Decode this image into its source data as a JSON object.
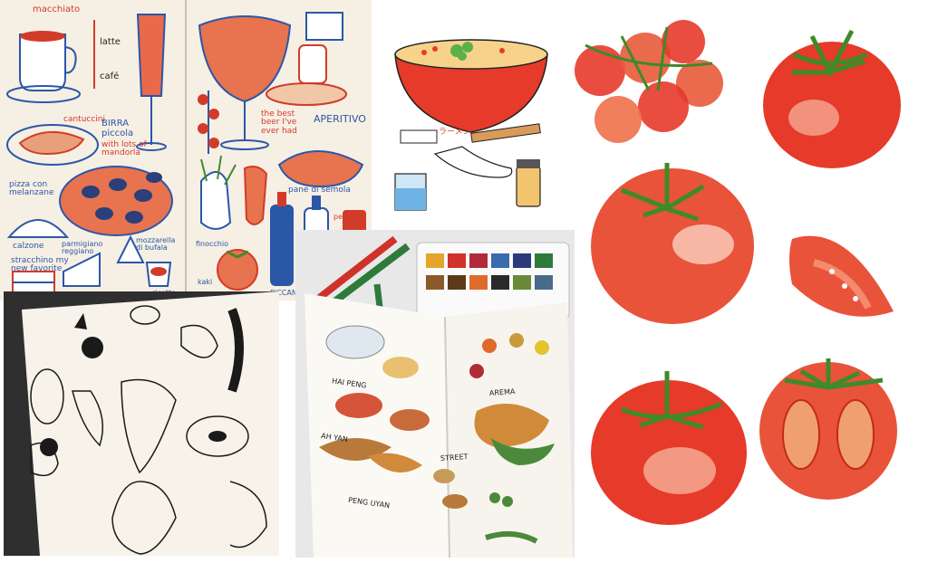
{
  "food_sketchbook": {
    "p1": "macchiato",
    "p2": "latte",
    "p3": "café",
    "p4": "cantuccini",
    "p5": "BIRRA piccola",
    "p6": "with lots of mandorla",
    "p7": "pizza con melanzane",
    "p8": "calzone",
    "p9": "parmigiano reggiano",
    "p10": "mozzarella di bufala",
    "p11": "stracchino my new favorite",
    "p12": "ricotta",
    "p13": "the best beer I've ever had",
    "p14": "APERITIVO",
    "p15": "pane di semola",
    "p16": "finocchio",
    "p17": "kaki",
    "p18": "PICCANTE",
    "p19": "per"
  },
  "ramen_illustration": {
    "chopstick_wrapper_text": "ラーメン"
  },
  "travel_sketchbook": {
    "t1": "HAI PENG",
    "t2": "AH YAN",
    "t3": "AREMA",
    "t4": "STREET",
    "t5": "PENG UYAN"
  },
  "colors": {
    "tomato_red": "#e63a2a",
    "tomato_light": "#f58a6e",
    "stem_green": "#3f8a2a",
    "sketch_red": "#d23b2a",
    "sketch_blue": "#2b57a8",
    "paper": "#f7f1e6"
  }
}
